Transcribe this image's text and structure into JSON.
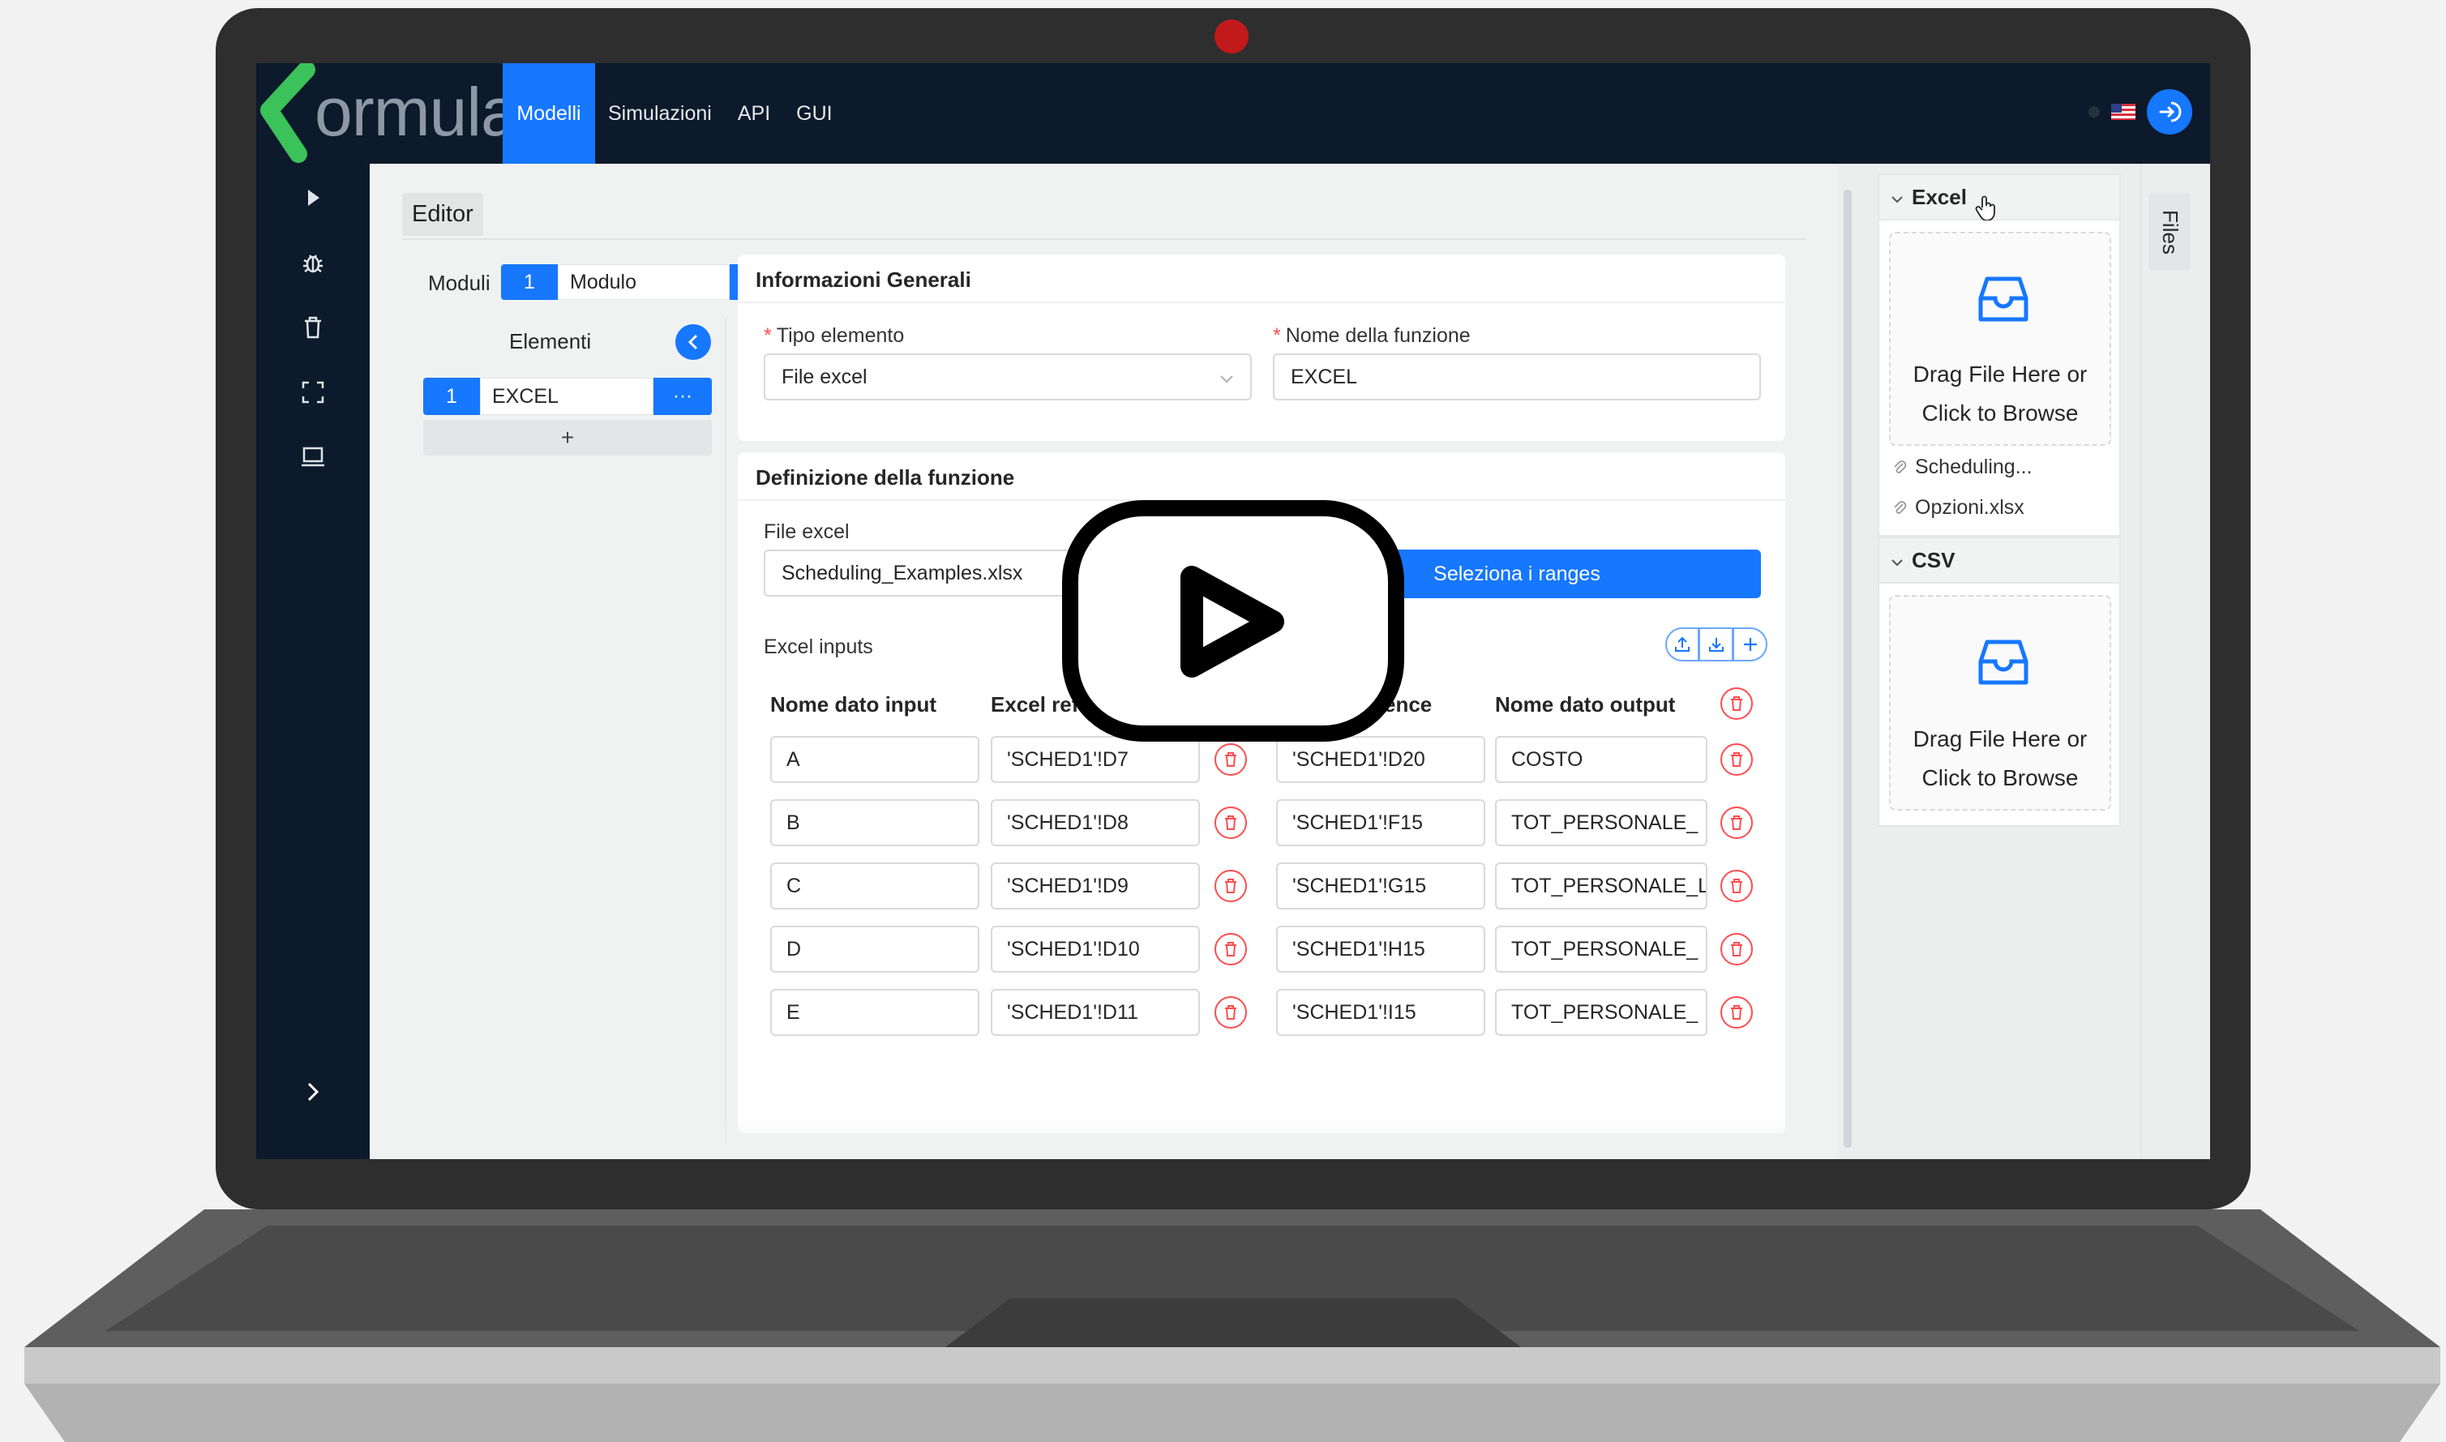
{
  "app": {
    "logo_text": "ormulas"
  },
  "nav": {
    "items": [
      {
        "label": "Modelli",
        "active": true
      },
      {
        "label": "Simulazioni",
        "active": false
      },
      {
        "label": "API",
        "active": false
      },
      {
        "label": "GUI",
        "active": false
      }
    ]
  },
  "editor": {
    "tab_label": "Editor",
    "moduli": {
      "label": "Moduli",
      "number": "1",
      "name": "Modulo",
      "more": "···",
      "add": "+"
    },
    "elementi": {
      "label": "Elementi",
      "item_number": "1",
      "item_name": "EXCEL",
      "more": "···",
      "add": "+"
    }
  },
  "general_info": {
    "title": "Informazioni Generali",
    "tipo_label": "Tipo elemento",
    "tipo_value": "File excel",
    "nome_label": "Nome della funzione",
    "nome_value": "EXCEL",
    "required_mark": "*"
  },
  "definition": {
    "title": "Definizione della funzione",
    "file_label": "File excel",
    "file_value": "Scheduling_Examples.xlsx",
    "select_ranges_label": "Seleziona i ranges",
    "inputs_label": "Excel inputs",
    "outputs_label_partial": "uts",
    "input_headers": [
      "Nome dato input",
      "Excel reference"
    ],
    "output_headers": [
      "Excel reference",
      "Nome dato output"
    ],
    "rows": [
      {
        "input_name": "A",
        "input_ref": "'SCHED1'!D7",
        "output_ref": "'SCHED1'!D20",
        "output_name": "COSTO"
      },
      {
        "input_name": "B",
        "input_ref": "'SCHED1'!D8",
        "output_ref": "'SCHED1'!F15",
        "output_name": "TOT_PERSONALE_"
      },
      {
        "input_name": "C",
        "input_ref": "'SCHED1'!D9",
        "output_ref": "'SCHED1'!G15",
        "output_name": "TOT_PERSONALE_L"
      },
      {
        "input_name": "D",
        "input_ref": "'SCHED1'!D10",
        "output_ref": "'SCHED1'!H15",
        "output_name": "TOT_PERSONALE_"
      },
      {
        "input_name": "E",
        "input_ref": "'SCHED1'!D11",
        "output_ref": "'SCHED1'!I15",
        "output_name": "TOT_PERSONALE_"
      }
    ]
  },
  "files_panel": {
    "tab_label": "Files",
    "excel": {
      "title": "Excel",
      "drop_line1": "Drag File Here or",
      "drop_line2": "Click to Browse",
      "files": [
        "Scheduling...",
        "Opzioni.xlsx"
      ]
    },
    "csv": {
      "title": "CSV",
      "drop_line1": "Drag File Here or",
      "drop_line2": "Click to Browse"
    }
  },
  "colors": {
    "primary": "#1677ff",
    "topbar": "#0c1a2b",
    "danger": "#ff4d4f",
    "logo_green": "#3cc25a"
  },
  "icons": {
    "sidebar": [
      "play-icon",
      "bug-icon",
      "trash-icon",
      "fullscreen-icon",
      "laptop-icon"
    ],
    "overlay": "video-play-icon"
  }
}
